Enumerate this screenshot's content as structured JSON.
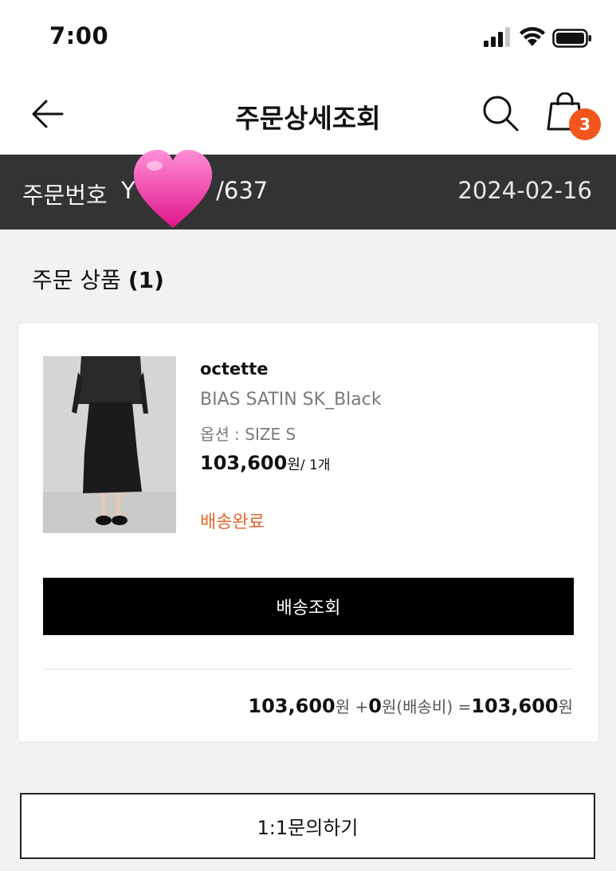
{
  "status_bar": {
    "time": "7:00"
  },
  "nav": {
    "title": "주문상세조회",
    "cart_count": "3"
  },
  "order": {
    "label": "주문번호",
    "number": "Y           /637",
    "date": "2024-02-16"
  },
  "section": {
    "title": "주문 상품",
    "count": "(1)"
  },
  "product": {
    "brand": "octette",
    "name": "BIAS SATIN SK_Black",
    "option": "옵션 : SIZE S",
    "price": "103,600",
    "price_unit": "원",
    "quantity": "/ 1개",
    "status": "배송완료"
  },
  "buttons": {
    "track": "배송조회",
    "inquiry": "1:1문의하기"
  },
  "total": {
    "product_amount": "103,600",
    "won1": "원",
    "plus": " +",
    "shipping": "0",
    "won2": "원",
    "shipping_label": "(배송비) =",
    "grand_total": "103,600",
    "won3": "원"
  },
  "colors": {
    "accent": "#f2561d",
    "status": "#e4652b",
    "order_bar": "#333333"
  },
  "icons": [
    "back-arrow-icon",
    "search-icon",
    "shopping-bag-icon",
    "heart-sticker-icon",
    "signal-icon",
    "wifi-icon",
    "battery-icon"
  ]
}
